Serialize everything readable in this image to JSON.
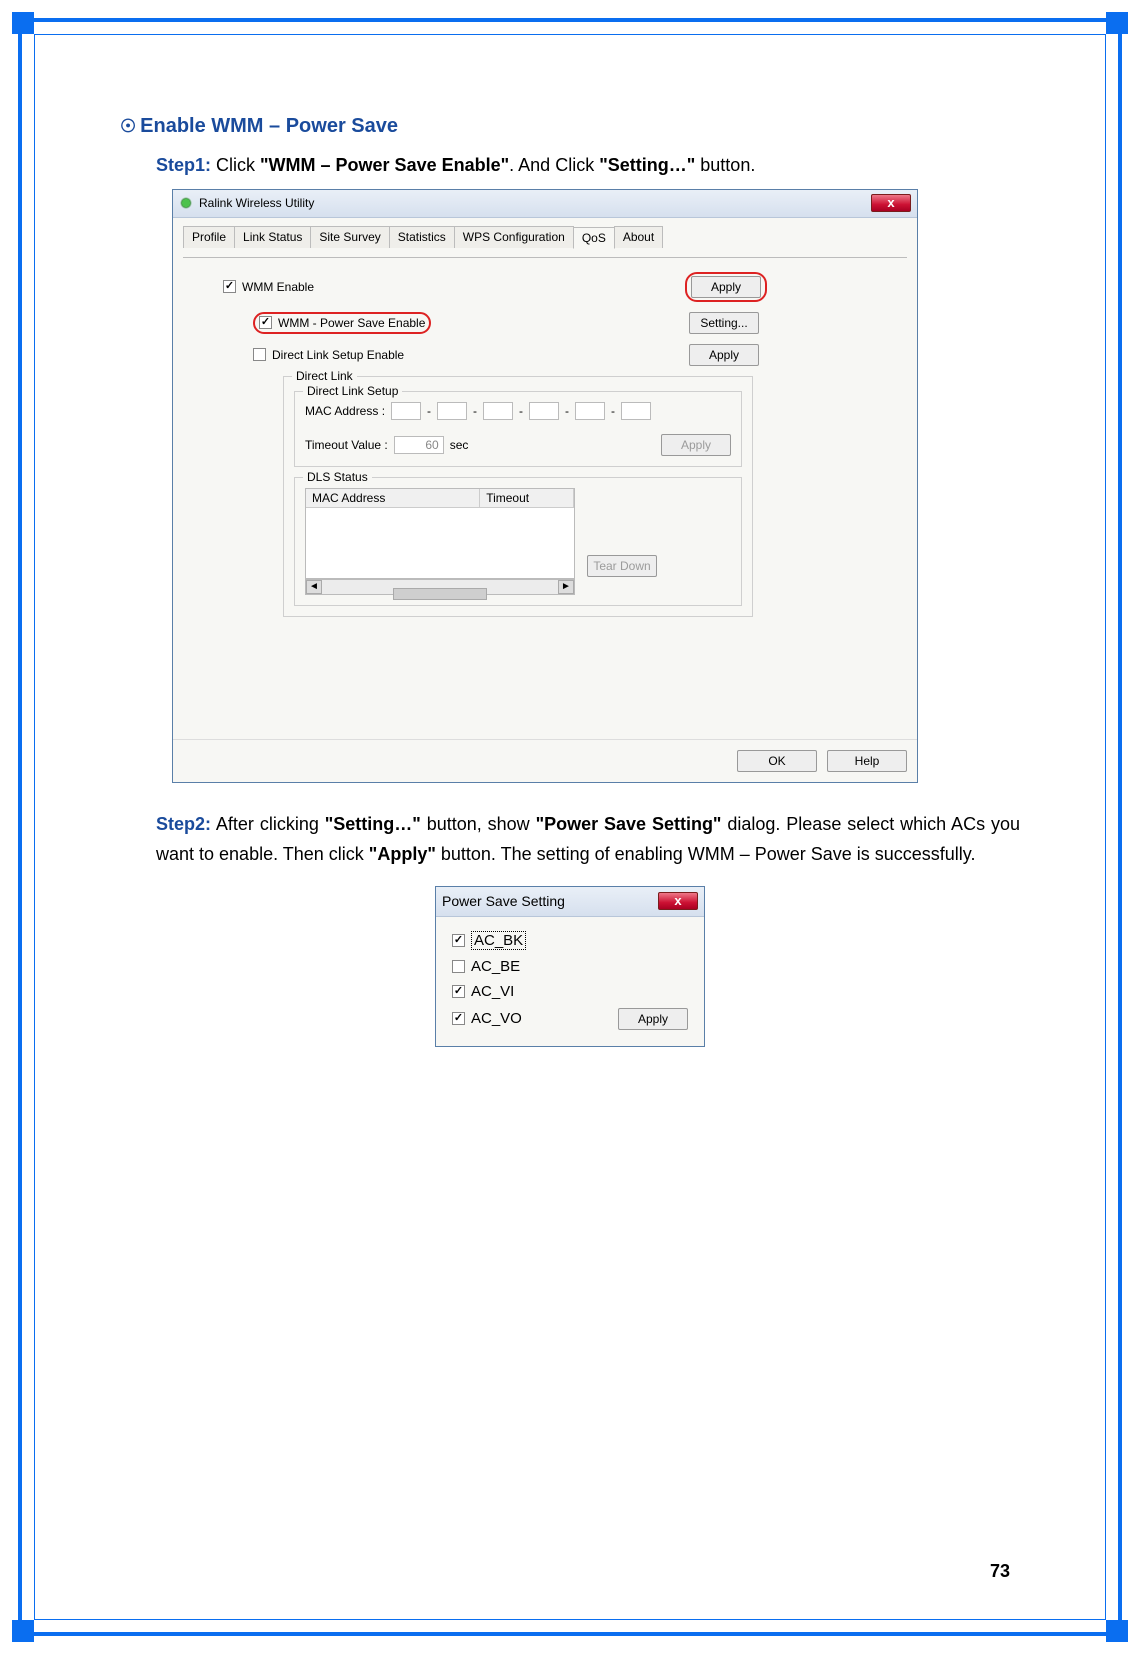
{
  "section_title": "Enable WMM – Power Save",
  "step1": {
    "label": "Step1:",
    "pre": " Click ",
    "b1": "\"WMM – Power Save Enable\"",
    "mid": ". And Click ",
    "b2": "\"Setting…\"",
    "post": " button."
  },
  "step2": {
    "label": "Step2:",
    "t1": " After clicking ",
    "b1": "\"Setting…\"",
    "t2": " button, show ",
    "b2": "\"Power Save Setting\"",
    "t3": " dialog. Please select which ACs you want to enable. Then click ",
    "b3": "\"Apply\"",
    "t4": " button. The setting of enabling WMM – Power Save is successfully."
  },
  "dlg1": {
    "title": "Ralink Wireless Utility",
    "tabs": [
      "Profile",
      "Link Status",
      "Site Survey",
      "Statistics",
      "WPS Configuration",
      "QoS",
      "About"
    ],
    "active_tab_index": 5,
    "wmm_enable": "WMM Enable",
    "wmm_ps_enable": "WMM - Power Save Enable",
    "direct_link_setup_enable": "Direct Link Setup Enable",
    "apply": "Apply",
    "setting": "Setting...",
    "direct_link_legend": "Direct Link",
    "direct_link_setup_legend": "Direct Link Setup",
    "mac_label": "MAC Address :",
    "timeout_label": "Timeout Value :",
    "timeout_value": "60",
    "sec": "sec",
    "dls_status_legend": "DLS Status",
    "col_mac": "MAC Address",
    "col_timeout": "Timeout",
    "tear_down": "Tear Down",
    "ok": "OK",
    "help": "Help"
  },
  "dlg2": {
    "title": "Power Save Setting",
    "ac_bk": "AC_BK",
    "ac_be": "AC_BE",
    "ac_vi": "AC_VI",
    "ac_vo": "AC_VO",
    "apply": "Apply",
    "checks": {
      "bk": true,
      "be": false,
      "vi": true,
      "vo": true
    }
  },
  "page_number": "73"
}
